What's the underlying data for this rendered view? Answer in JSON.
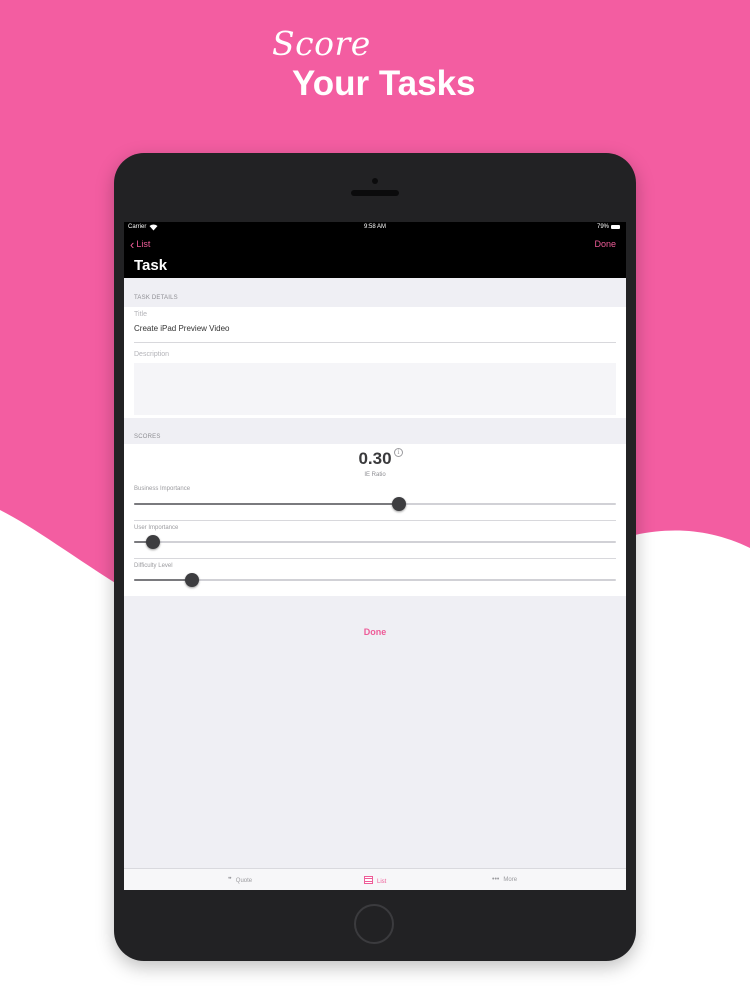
{
  "promo": {
    "script_text": "Score",
    "bold_text": "Your Tasks",
    "background_color": "#f35da1"
  },
  "statusbar": {
    "carrier": "Carrier",
    "wifi_icon": "wifi-icon",
    "time": "9:58 AM",
    "battery": "79%"
  },
  "navbar": {
    "back_label": "List",
    "done_label": "Done",
    "title": "Task",
    "accent_color": "#ee5c98"
  },
  "task_details": {
    "section_header": "TASK DETAILS",
    "title_label": "Title",
    "title_value": "Create iPad Preview Video",
    "description_label": "Description",
    "description_value": ""
  },
  "scores": {
    "section_header": "SCORES",
    "score_value": "0.30",
    "score_caption": "IE Ratio",
    "info_icon": "info-icon",
    "sliders": [
      {
        "label": "Business Importance",
        "value": 0.55
      },
      {
        "label": "User Importance",
        "value": 0.04
      },
      {
        "label": "Difficulty Level",
        "value": 0.12
      }
    ]
  },
  "done_button": "Done",
  "tabbar": {
    "tabs": [
      {
        "label": "Quote",
        "icon": "quote-icon",
        "active": false
      },
      {
        "label": "List",
        "icon": "list-icon",
        "active": true
      },
      {
        "label": "More",
        "icon": "more-icon",
        "active": false
      }
    ]
  }
}
